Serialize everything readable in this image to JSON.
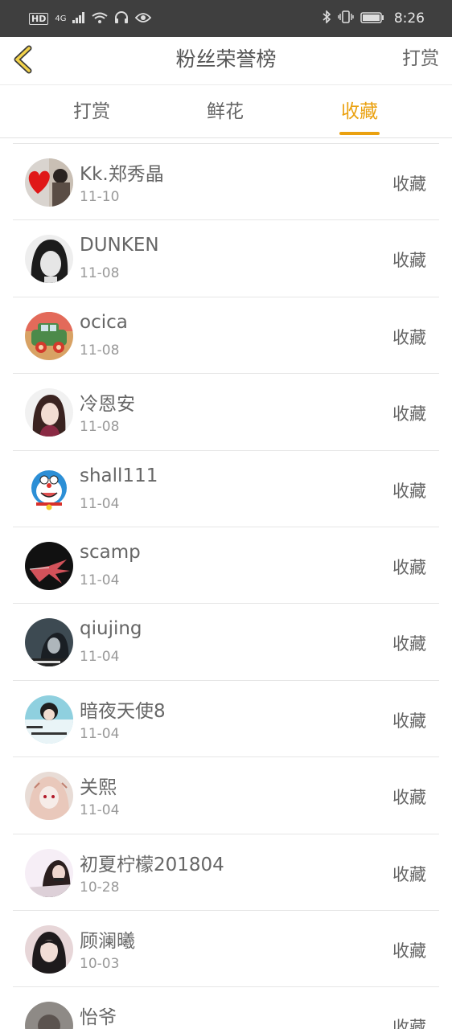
{
  "status_bar": {
    "hd_label": "HD",
    "network_label": "4G",
    "time": "8:26",
    "icons": [
      "signal-icon",
      "wifi-icon",
      "headphones-icon",
      "eye-icon",
      "bluetooth-icon",
      "vibrate-icon",
      "battery-icon"
    ]
  },
  "nav": {
    "title": "粉丝荣誉榜",
    "action": "打赏",
    "back_icon": "chevron-left-icon",
    "accent_color": "#eaa110"
  },
  "tabs": [
    {
      "label": "打赏",
      "active": false
    },
    {
      "label": "鲜花",
      "active": false
    },
    {
      "label": "收藏",
      "active": true
    }
  ],
  "list": {
    "items": [
      {
        "name": "Kk.郑秀晶",
        "date": "11-10",
        "action": "收藏"
      },
      {
        "name": "DUNKEN",
        "date": "11-08",
        "action": "收藏"
      },
      {
        "name": "ocica",
        "date": "11-08",
        "action": "收藏"
      },
      {
        "name": "冷恩安",
        "date": "11-08",
        "action": "收藏"
      },
      {
        "name": "shall111",
        "date": "11-04",
        "action": "收藏"
      },
      {
        "name": "scamp",
        "date": "11-04",
        "action": "收藏"
      },
      {
        "name": "qiujing",
        "date": "11-04",
        "action": "收藏"
      },
      {
        "name": "暗夜天使8",
        "date": "11-04",
        "action": "收藏"
      },
      {
        "name": "关熙",
        "date": "11-04",
        "action": "收藏"
      },
      {
        "name": "初夏柠檬201804",
        "date": "10-28",
        "action": "收藏"
      },
      {
        "name": "顾澜曦",
        "date": "10-03",
        "action": "收藏"
      },
      {
        "name": "怡爷",
        "date": "",
        "action": "收藏"
      }
    ]
  }
}
